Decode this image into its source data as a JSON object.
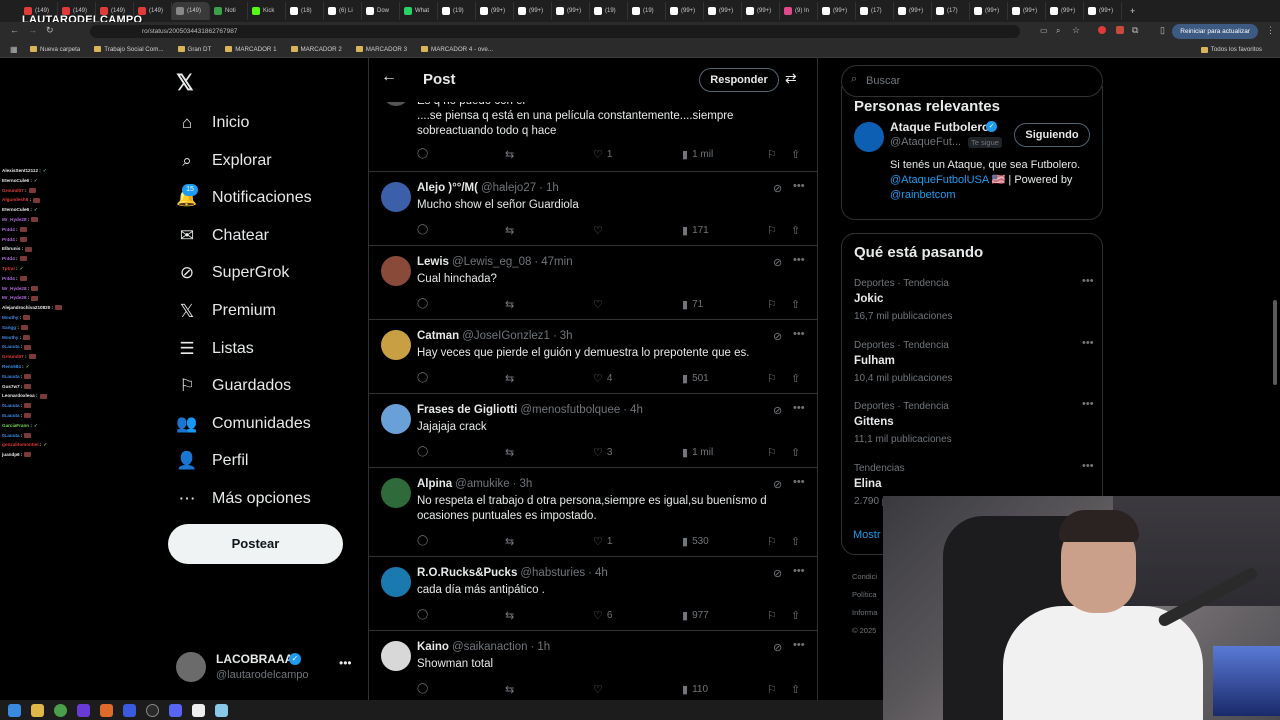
{
  "browser": {
    "tabs": [
      "(149)",
      "(149)",
      "(149)",
      "(149)",
      "(149)",
      "Noti",
      "Kick",
      "(18)",
      "(6) Li",
      "Dow",
      "What",
      "(19)",
      "(99+)",
      "(99+)",
      "(99+)",
      "(19)",
      "(19)",
      "(99+)",
      "(99+)",
      "(99+)",
      "(9) In",
      "(99+)",
      "(17)",
      "(99+)",
      "(17)",
      "(99+)",
      "(99+)",
      "(99+)",
      "(99+)"
    ],
    "url": "ro/status/2005034431862767987",
    "update_label": "Reiniciar para actualizar",
    "bookmarks": [
      "Nueva carpeta",
      "Trabajo Social Com...",
      "Gran DT",
      "MARCADOR 1",
      "MARCADOR 2",
      "MARCADOR 3",
      "MARCADOR 4 - ove..."
    ],
    "all_bookmarks": "Todos los favoritos",
    "overlay_logo": "LAUTARODELCAMPO"
  },
  "chat": [
    {
      "user": "AlexisSent12112",
      "color": "#e7e9ea",
      "mark": "ok"
    },
    {
      "user": "EternoCule6",
      "color": "#e7e9ea",
      "mark": "ok"
    },
    {
      "user": "Ground07",
      "color": "#e03a3a",
      "mark": "badge"
    },
    {
      "user": "Algundesh6",
      "color": "#e03a3a",
      "mark": "badge"
    },
    {
      "user": "EternoCule6",
      "color": "#e7e9ea",
      "mark": "ok"
    },
    {
      "user": "Mr_Hyde28",
      "color": "#b46ae0",
      "mark": "badge"
    },
    {
      "user": "Pr4d4",
      "color": "#b46ae0",
      "mark": "badge"
    },
    {
      "user": "Pr4d4",
      "color": "#b46ae0",
      "mark": "badge"
    },
    {
      "user": "Elbrunis",
      "color": "#e7e9ea",
      "mark": "badge"
    },
    {
      "user": "Pr4d4",
      "color": "#b46ae0",
      "mark": "badge"
    },
    {
      "user": "Tptrai",
      "color": "#e03a3a",
      "mark": "ok"
    },
    {
      "user": "Pr4d4",
      "color": "#b46ae0",
      "mark": "badge"
    },
    {
      "user": "Mr_Hyde28",
      "color": "#b46ae0",
      "mark": "badge"
    },
    {
      "user": "Mr_Hyde28",
      "color": "#b46ae0",
      "mark": "badge"
    },
    {
      "user": "Alejandrochiva210820",
      "color": "#e7e9ea",
      "mark": "badge"
    },
    {
      "user": "Mouthy",
      "color": "#3a8ae0",
      "mark": "badge"
    },
    {
      "user": "Sangg",
      "color": "#3a8ae0",
      "mark": "badge"
    },
    {
      "user": "Mouthy",
      "color": "#3a8ae0",
      "mark": "badge"
    },
    {
      "user": "0Lauuta",
      "color": "#3a8ae0",
      "mark": "badge"
    },
    {
      "user": "Ground07",
      "color": "#e03a3a",
      "mark": "badge"
    },
    {
      "user": "Rens684",
      "color": "#3a8ae0",
      "mark": "ok"
    },
    {
      "user": "0Lauuta",
      "color": "#3a8ae0",
      "mark": "badge"
    },
    {
      "user": "Gus7w7",
      "color": "#e7e9ea",
      "mark": "badge"
    },
    {
      "user": "Leonardoxleoa",
      "color": "#e7e9ea",
      "mark": "badge"
    },
    {
      "user": "0Lauuta",
      "color": "#3a8ae0",
      "mark": "badge"
    },
    {
      "user": "0Lauuta",
      "color": "#3a8ae0",
      "mark": "badge"
    },
    {
      "user": "GarciaFrann",
      "color": "#7ad35a",
      "mark": "ok"
    },
    {
      "user": "0Lauuta",
      "color": "#3a8ae0",
      "mark": "badge"
    },
    {
      "user": "gonzalitomontiel",
      "color": "#e03a3a",
      "mark": "ok"
    },
    {
      "user": "juandp6",
      "color": "#e7e9ea",
      "mark": "badge"
    }
  ],
  "nav": {
    "items": [
      "Inicio",
      "Explorar",
      "Notificaciones",
      "Chatear",
      "SuperGrok",
      "Premium",
      "Listas",
      "Guardados",
      "Comunidades",
      "Perfil",
      "Más opciones"
    ],
    "notif_count": "15",
    "post_button": "Postear"
  },
  "profile": {
    "name": "LACOBRAAA",
    "handle": "@lautarodelcampo"
  },
  "main": {
    "title": "Post",
    "reply_button": "Responder",
    "partial_text": "Es q no puedo con el\n....se piensa q está en una película constantemente....siempre sobreactuando todo q hace",
    "partial_actions": {
      "likes": "1",
      "views": "1 mil"
    },
    "replies": [
      {
        "name": "Alejo )°°/M(",
        "handle": "@halejo27",
        "time": "1h",
        "text": "Mucho show el señor Guardiola",
        "likes": "",
        "views": "171",
        "avatar": "#3b5fa8"
      },
      {
        "name": "Lewis",
        "handle": "@Lewis_eg_08",
        "time": "47min",
        "text": "Cual hinchada?",
        "likes": "",
        "views": "71",
        "avatar": "#8a4a3a"
      },
      {
        "name": "Catman",
        "handle": "@JoseIGonzlez1",
        "time": "3h",
        "text": "Hay veces que pierde el guión  y demuestra lo prepotente que es.",
        "likes": "4",
        "views": "501",
        "avatar": "#c8a043"
      },
      {
        "name": "Frases de Gigliotti",
        "handle": "@menosfutbolquee",
        "time": "4h",
        "text": "Jajajaja crack",
        "likes": "3",
        "views": "1 mil",
        "avatar": "#6aa0d8"
      },
      {
        "name": "Alpina",
        "handle": "@amukike",
        "time": "3h",
        "text": "No respeta el trabajo d otra persona,siempre es igual,su buenísmo d ocasiones puntuales es impostado.",
        "likes": "1",
        "views": "530",
        "avatar": "#2f6a3a"
      },
      {
        "name": "R.O.Rucks&Pucks",
        "handle": "@habsturies",
        "time": "4h",
        "text": "cada día más antipático .",
        "likes": "6",
        "views": "977",
        "avatar": "#1a7ab0"
      },
      {
        "name": "Kaino",
        "handle": "@saikanaction",
        "time": "1h",
        "text": "Showman total",
        "likes": "",
        "views": "110",
        "avatar": "#d8d8d8"
      }
    ]
  },
  "right": {
    "search_placeholder": "Buscar",
    "relevant_title": "Personas relevantes",
    "relevant": {
      "name": "Ataque Futbolero",
      "handle": "@AtaqueFut...",
      "follows_you": "Te sigue",
      "button": "Siguiendo",
      "bio_pre": "Si tenés un Ataque, que sea Futbolero.",
      "bio_link1": "@AtaqueFutbolUSA",
      "bio_mid": " 🇺🇸 | Powered by",
      "bio_link2": "@rainbetcom"
    },
    "trending_title": "Qué está pasando",
    "trends": [
      {
        "category": "Deportes · Tendencia",
        "name": "Jokic",
        "count": "16,7 mil publicaciones"
      },
      {
        "category": "Deportes · Tendencia",
        "name": "Fulham",
        "count": "10,4 mil publicaciones"
      },
      {
        "category": "Deportes · Tendencia",
        "name": "Gittens",
        "count": "11,1 mil publicaciones"
      },
      {
        "category": "Tendencias",
        "name": "Elina",
        "count": "2.790 p"
      }
    ],
    "show_more": "Mostr",
    "footer": [
      "Condici",
      "Política",
      "Informa",
      "© 2025"
    ]
  }
}
